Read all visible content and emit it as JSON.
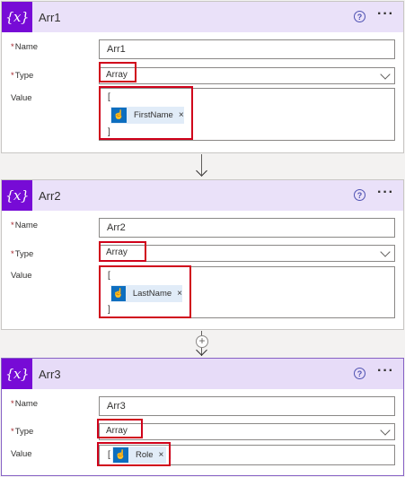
{
  "labels": {
    "name": "Name",
    "type": "Type",
    "value": "Value",
    "required_mark": "*"
  },
  "glyphs": {
    "open_bracket": "[",
    "close_bracket": "]",
    "close": "×",
    "more": "···",
    "help": "?",
    "plus": "+"
  },
  "actions": [
    {
      "title": "Arr1",
      "name_value": "Arr1",
      "type_value": "Array",
      "token_label": "FirstName"
    },
    {
      "title": "Arr2",
      "name_value": "Arr2",
      "type_value": "Array",
      "token_label": "LastName"
    },
    {
      "title": "Arr3",
      "name_value": "Arr3",
      "type_value": "Array",
      "token_label": "Role"
    }
  ],
  "colors": {
    "header_bg": "#eae1f9",
    "icon_bg": "#770bd6",
    "token_icon_bg": "#0d6ebf",
    "highlight": "#d0021b"
  },
  "icons": {
    "header_icon": "variable-icon",
    "token_icon": "manual-trigger-icon",
    "help_icon": "help-icon",
    "menu_icon": "more-options-icon"
  }
}
